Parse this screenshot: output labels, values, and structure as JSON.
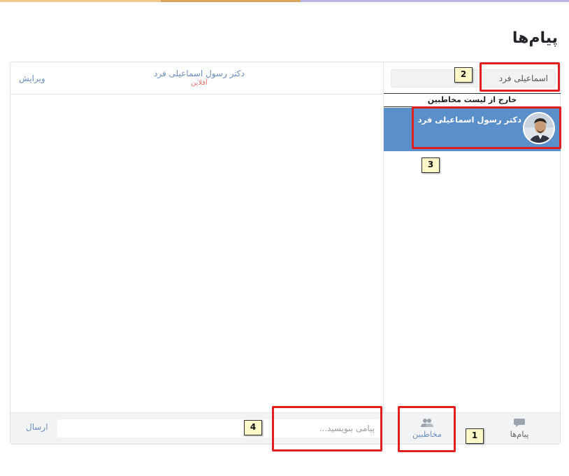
{
  "page": {
    "title": "پیام‌ها"
  },
  "chat": {
    "contact_name": "دکتر رسول اسماعیلی فرد",
    "status": "آفلاین",
    "edit_label": "ویرایش"
  },
  "sidebar": {
    "search_value": "اسماعیلی فرد",
    "group_label": "خارج از لیست مخاطبین",
    "contacts": [
      {
        "name": "دکتر رسول اسماعیلی فرد",
        "avatar": "person-photo"
      }
    ]
  },
  "composer": {
    "placeholder": "پیامی بنویسید...",
    "send_label": "ارسال"
  },
  "tabs": {
    "contacts_label": "مخاطبین",
    "contacts_icon": "contacts-icon",
    "messages_label": "پیام‌ها",
    "messages_icon": "chat-bubble-icon"
  },
  "annotations": {
    "b1": "1",
    "b2": "2",
    "b3": "3",
    "b4": "4"
  },
  "colors": {
    "accent": "#5b8fc9",
    "link": "#6c8fbf",
    "offline": "#e0776f",
    "highlight": "#e02020",
    "badge_bg": "#fff8c8"
  }
}
